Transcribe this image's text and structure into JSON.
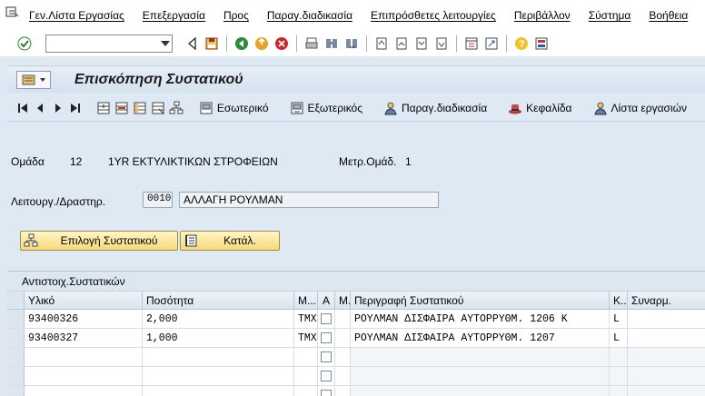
{
  "menu": [
    "Γεν.Λίστα Εργασίας",
    "Επεξεργασία",
    "Προς",
    "Παραγ.διαδικασία",
    "Επιπρόσθετες λειτουργίες",
    "Περιβάλλον",
    "Σύστημα",
    "Βοήθεια"
  ],
  "command_field": {
    "value": ""
  },
  "title": "Επισκόπηση Συστατικού",
  "app_toolbar": {
    "internal": "Εσωτερικό",
    "external": "Εξωτερικός",
    "routing": "Παραγ.διαδικασία",
    "header": "Κεφαλίδα",
    "task_list": "Λίστα εργασιών"
  },
  "header": {
    "group_label": "Ομάδα",
    "group_value": "12",
    "group_desc": "1YR ΕΚΤΥΛΙΚΤΙΚΩΝ ΣΤΡΟΦΕΙΩΝ",
    "counter_label": "Μετρ.Ομάδ.",
    "counter_value": "1",
    "operation_label": "Λειτουργ./Δραστηρ.",
    "operation_value": "0010",
    "operation_desc": "ΑΛΛΑΓΗ ΡΟΥΛΜΑΝ"
  },
  "buttons": {
    "select_component": "Επιλογή Συστατικού",
    "catalog": "Κατάλ."
  },
  "table": {
    "title": "Αντιστοιχ.Συστατικών",
    "columns": [
      "Υλικό",
      "Ποσότητα",
      "Μ...",
      "Α",
      "Μ.",
      "Περιγραφή Συστατικού",
      "Κ..",
      "Συναρμ."
    ],
    "rows": [
      {
        "material": "93400326",
        "qty": "2,000",
        "unit": "ΤΜΧ",
        "desc": "ΡΟΥΛΜΑΝ ΔΙΣΦΑΙΡΑ ΑΥΤΟΡΡΥΘΜ.  1206 K",
        "cat": "L"
      },
      {
        "material": "93400327",
        "qty": "1,000",
        "unit": "ΤΜΧ",
        "desc": "ΡΟΥΛΜΑΝ ΔΙΣΦΑΙΡΑ ΑΥΤΟΡΡΥΘΜ.  1207",
        "cat": "L"
      }
    ]
  }
}
